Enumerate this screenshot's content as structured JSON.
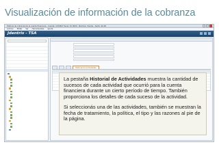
{
  "slide": {
    "title": "Visualización de información de la cobranza"
  },
  "app": {
    "brand": "Jdentrix - TSA",
    "window_title": "Historia de cobranza de la cuenta financiera - Cuenta: 1234567 Serie: 01 0000 - Nombre: Cliente - Saldo: $0.00",
    "menu": [
      "Archivo",
      "Editar",
      "Ver",
      "Herramientas",
      "Ayuda"
    ]
  },
  "sidebar": {
    "items": [
      "",
      "",
      "",
      "",
      "",
      "",
      ""
    ],
    "tree": [
      "",
      "",
      "",
      "",
      "",
      "",
      "",
      "",
      "",
      "",
      "",
      "",
      "",
      "",
      "",
      "",
      "",
      "",
      "",
      ""
    ]
  },
  "main": {
    "tabs": [
      "",
      "",
      "",
      "Historial de Actividades"
    ],
    "active_tab_index": 3
  },
  "callout": {
    "p1_before": "La pestaña ",
    "p1_bold": "Historial de Actividades",
    "p1_after": " muestra la cantidad de sucesos de cada actividad que ocurrió para la cuenta financiera durante un cierto período de tiempo. También proporciona los detalles de cada suceso de la actividad.",
    "p2": "Si seleccionás una de las actividades, también se muestran la fecha de tratamiento, la política, el tipo y las razones al pie de la página."
  },
  "colors": {
    "title": "#5a8a9e",
    "brand_bar": "#1c4269",
    "active_tab": "#d38a2f",
    "callout_bg": "#f4f3ec"
  }
}
